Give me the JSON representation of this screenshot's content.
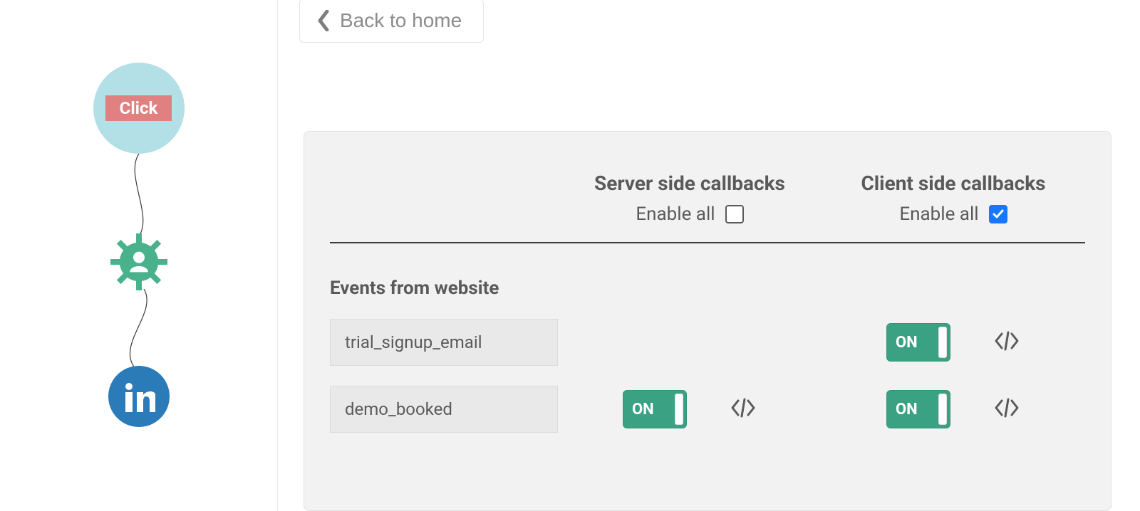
{
  "header": {
    "back_label": "Back to home"
  },
  "sidebar": {
    "click_label": "Click",
    "linkedin_label": "in"
  },
  "columns": {
    "server": {
      "title": "Server side callbacks",
      "enable_all_label": "Enable all",
      "enable_all_checked": false
    },
    "client": {
      "title": "Client side callbacks",
      "enable_all_label": "Enable all",
      "enable_all_checked": true
    }
  },
  "section_title": "Events from website",
  "toggle_on_label": "ON",
  "events": [
    {
      "name": "trial_signup_email",
      "server": {
        "toggle": null,
        "code": false
      },
      "client": {
        "toggle": true,
        "code": true
      }
    },
    {
      "name": "demo_booked",
      "server": {
        "toggle": true,
        "code": true
      },
      "client": {
        "toggle": true,
        "code": true
      }
    }
  ]
}
